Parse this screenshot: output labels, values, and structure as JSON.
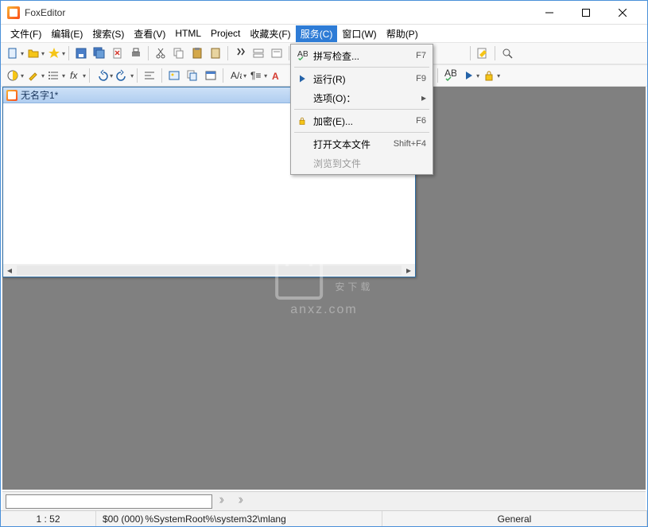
{
  "app": {
    "title": "FoxEditor"
  },
  "menubar": [
    {
      "label": "文件(F)"
    },
    {
      "label": "编辑(E)"
    },
    {
      "label": "搜索(S)"
    },
    {
      "label": "查看(V)"
    },
    {
      "label": "HTML"
    },
    {
      "label": "Project"
    },
    {
      "label": "收藏夹(F)"
    },
    {
      "label": "服务(C)",
      "active": true
    },
    {
      "label": "窗口(W)"
    },
    {
      "label": "帮助(P)"
    }
  ],
  "dropdown": {
    "items": [
      {
        "icon": "spellcheck",
        "label": "拼写检查...",
        "shortcut": "F7"
      },
      {
        "sep": true
      },
      {
        "icon": "play",
        "label": "运行(R)",
        "shortcut": "F9"
      },
      {
        "label": "选项(O)：",
        "submenu": true
      },
      {
        "sep": true
      },
      {
        "icon": "lock",
        "label": "加密(E)...",
        "shortcut": "F6"
      },
      {
        "sep": true
      },
      {
        "label": "打开文本文件",
        "shortcut": "Shift+F4"
      },
      {
        "label": "浏览到文件",
        "disabled": true
      }
    ]
  },
  "document": {
    "title": "无名字1*"
  },
  "watermark": {
    "main": "安下载",
    "sub": "anxz.com"
  },
  "status": {
    "position": "1 : 52",
    "code": "$00 (000)",
    "path": "%SystemRoot%\\system32\\mlang",
    "mode": "General"
  },
  "search": {
    "placeholder": ""
  }
}
